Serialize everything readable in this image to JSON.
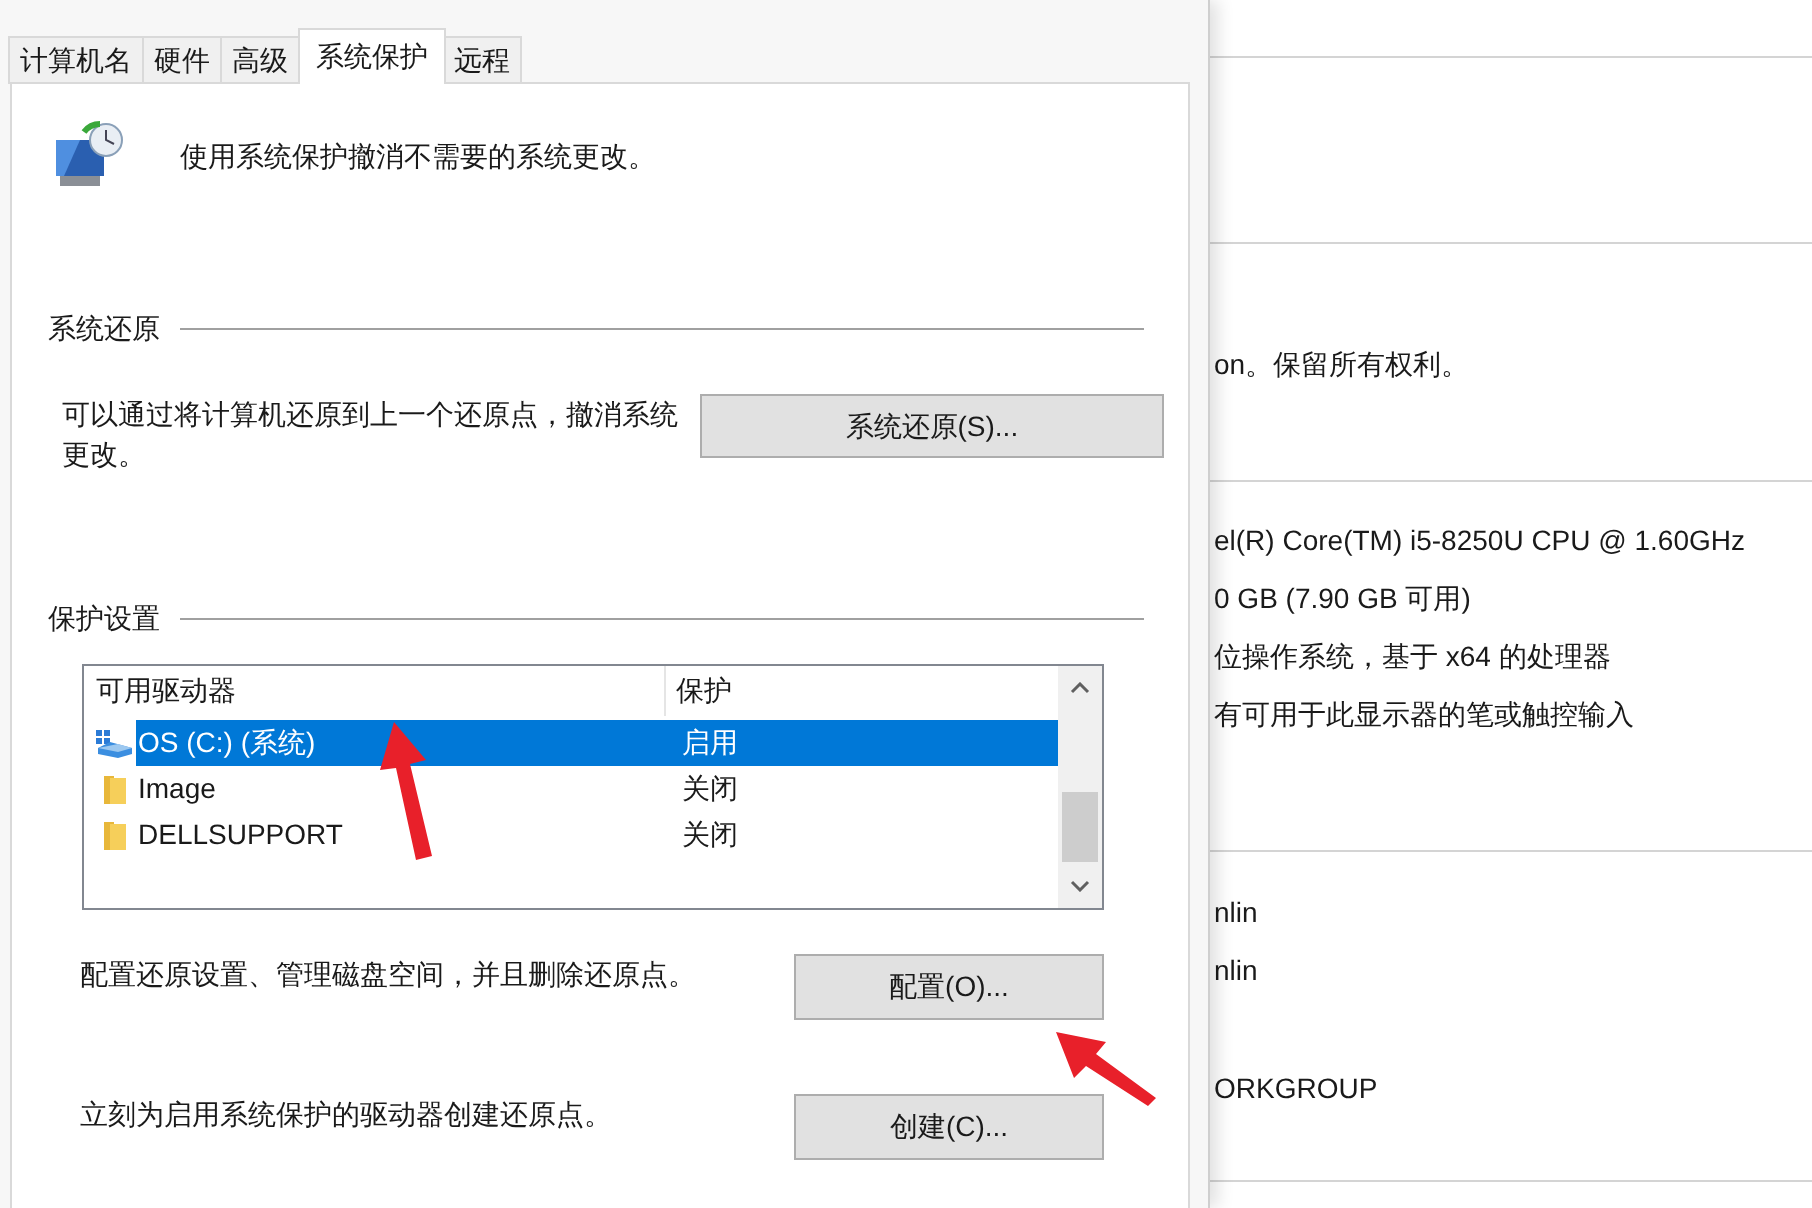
{
  "dialog": {
    "tabs": [
      {
        "label": "计算机名",
        "selected": false
      },
      {
        "label": "硬件",
        "selected": false
      },
      {
        "label": "高级",
        "selected": false
      },
      {
        "label": "系统保护",
        "selected": true
      },
      {
        "label": "远程",
        "selected": false
      }
    ],
    "description": "使用系统保护撤消不需要的系统更改。",
    "restore_group": {
      "title": "系统还原",
      "text": "可以通过将计算机还原到上一个还原点，撤消系统更改。",
      "button": "系统还原(S)..."
    },
    "protection_group": {
      "title": "保护设置",
      "columns": [
        "可用驱动器",
        "保护"
      ],
      "drives": [
        {
          "kind": "system",
          "name": "OS (C:) (系统)",
          "protection": "启用",
          "selected": true
        },
        {
          "kind": "folder",
          "name": "Image",
          "protection": "关闭",
          "selected": false
        },
        {
          "kind": "folder",
          "name": "DELLSUPPORT",
          "protection": "关闭",
          "selected": false
        }
      ]
    },
    "configure": {
      "text": "配置还原设置、管理磁盘空间，并且删除还原点。",
      "button": "配置(O)..."
    },
    "create": {
      "text": "立刻为启用系统保护的驱动器创建还原点。",
      "button": "创建(C)..."
    }
  },
  "background_window": {
    "sections": [
      {
        "lines": [
          "on。保留所有权利。"
        ]
      },
      {
        "lines": [
          "el(R) Core(TM) i5-8250U CPU @ 1.60GHz",
          "0 GB (7.90 GB 可用)",
          "位操作系统，基于 x64 的处理器",
          "有可用于此显示器的笔或触控输入"
        ]
      },
      {
        "lines": [
          "nlin",
          "nlin",
          "ORKGROUP"
        ]
      }
    ]
  }
}
